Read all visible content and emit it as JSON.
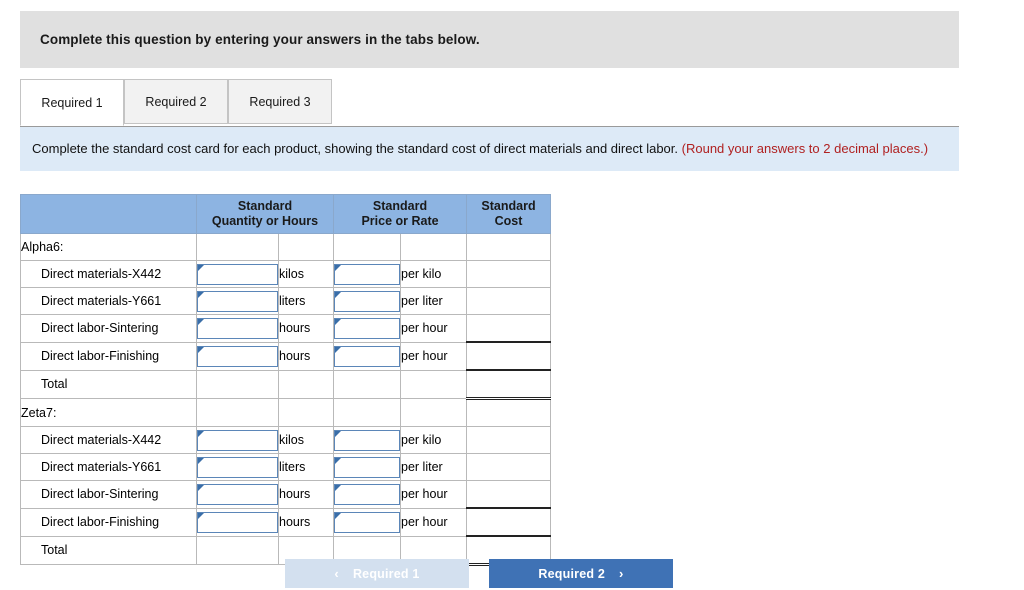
{
  "banner": {
    "text": "Complete this question by entering your answers in the tabs below."
  },
  "tabs": [
    {
      "label": "Required 1",
      "active": true
    },
    {
      "label": "Required 2",
      "active": false
    },
    {
      "label": "Required 3",
      "active": false
    }
  ],
  "instruction": {
    "main": "Complete the standard cost card for each product, showing the standard cost of direct materials and direct labor.",
    "round_note": "(Round your answers to 2 decimal places.)"
  },
  "table": {
    "headers": {
      "blank": "",
      "quantity": "Standard\nQuantity or Hours",
      "quantity_line1": "Standard",
      "quantity_line2": "Quantity or Hours",
      "price_line1": "Standard",
      "price_line2": "Price or Rate",
      "cost_line1": "Standard",
      "cost_line2": "Cost"
    },
    "sections": [
      {
        "title": "Alpha6:",
        "rows": [
          {
            "label": "Direct materials-X442",
            "qty_unit": "kilos",
            "rate_unit": "per kilo",
            "qty_value": "",
            "rate_value": "",
            "cost_value": ""
          },
          {
            "label": "Direct materials-Y661",
            "qty_unit": "liters",
            "rate_unit": "per liter",
            "qty_value": "",
            "rate_value": "",
            "cost_value": ""
          },
          {
            "label": "Direct labor-Sintering",
            "qty_unit": "hours",
            "rate_unit": "per hour",
            "qty_value": "",
            "rate_value": "",
            "cost_value": ""
          },
          {
            "label": "Direct labor-Finishing",
            "qty_unit": "hours",
            "rate_unit": "per hour",
            "qty_value": "",
            "rate_value": "",
            "cost_value": ""
          }
        ],
        "total_label": "Total",
        "total_value": ""
      },
      {
        "title": "Zeta7:",
        "rows": [
          {
            "label": "Direct materials-X442",
            "qty_unit": "kilos",
            "rate_unit": "per kilo",
            "qty_value": "",
            "rate_value": "",
            "cost_value": ""
          },
          {
            "label": "Direct materials-Y661",
            "qty_unit": "liters",
            "rate_unit": "per liter",
            "qty_value": "",
            "rate_value": "",
            "cost_value": ""
          },
          {
            "label": "Direct labor-Sintering",
            "qty_unit": "hours",
            "rate_unit": "per hour",
            "qty_value": "",
            "rate_value": "",
            "cost_value": ""
          },
          {
            "label": "Direct labor-Finishing",
            "qty_unit": "hours",
            "rate_unit": "per hour",
            "qty_value": "",
            "rate_value": "",
            "cost_value": ""
          }
        ],
        "total_label": "Total",
        "total_value": ""
      }
    ]
  },
  "nav": {
    "prev_label": "Required 1",
    "prev_chevron": "‹",
    "next_label": "Required 2",
    "next_chevron": "›",
    "prev_enabled": false,
    "next_enabled": true
  },
  "colors": {
    "banner_bg": "#e0e0e0",
    "instruction_bg": "#ddeaf7",
    "round_note_fg": "#b02121",
    "table_header_bg": "#8db4e2",
    "input_border": "#5b86b8",
    "input_marker": "#3a6ea8",
    "next_btn_bg": "#3f72b5",
    "prev_btn_bg": "#d3e0ef"
  }
}
